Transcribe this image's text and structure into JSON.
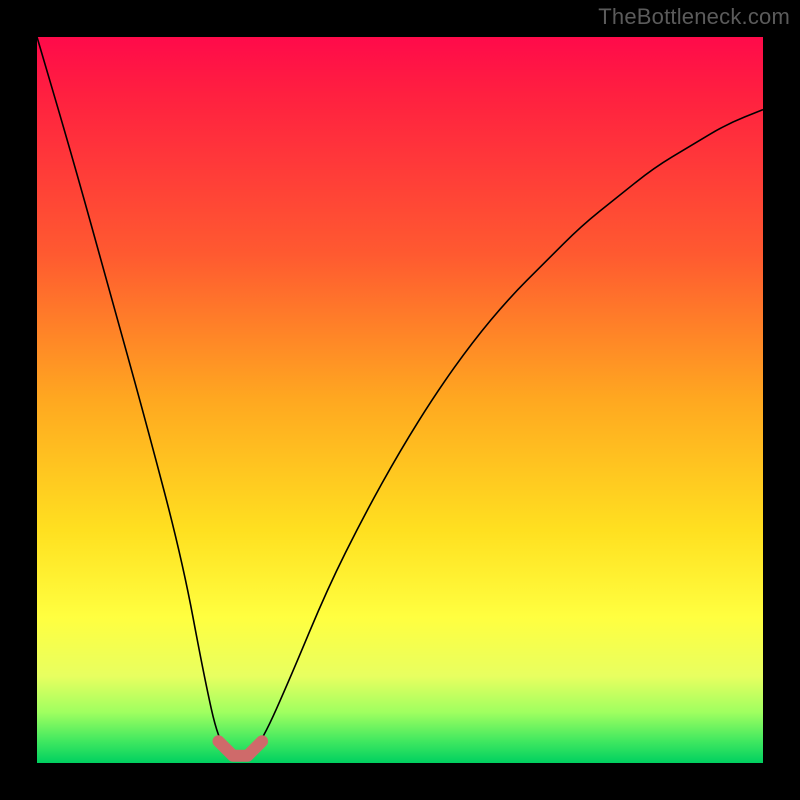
{
  "watermark": "TheBottleneck.com",
  "colors": {
    "background": "#000000",
    "curve_thin": "#000000",
    "curve_thick": "#cf6a6a",
    "gradient_top": "#ff0a4a",
    "gradient_bottom": "#00d060"
  },
  "chart_data": {
    "type": "line",
    "title": "",
    "xlabel": "",
    "ylabel": "",
    "xlim": [
      0,
      100
    ],
    "ylim": [
      0,
      100
    ],
    "x": [
      0,
      5,
      10,
      15,
      20,
      23,
      25,
      27,
      29,
      31,
      35,
      40,
      45,
      50,
      55,
      60,
      65,
      70,
      75,
      80,
      85,
      90,
      95,
      100
    ],
    "series": [
      {
        "name": "bottleneck-curve",
        "values": [
          100,
          83,
          65,
          47,
          28,
          12,
          3,
          1,
          1,
          3,
          12,
          24,
          34,
          43,
          51,
          58,
          64,
          69,
          74,
          78,
          82,
          85,
          88,
          90
        ]
      }
    ],
    "highlight_range_x": [
      25,
      31
    ],
    "annotations": []
  }
}
